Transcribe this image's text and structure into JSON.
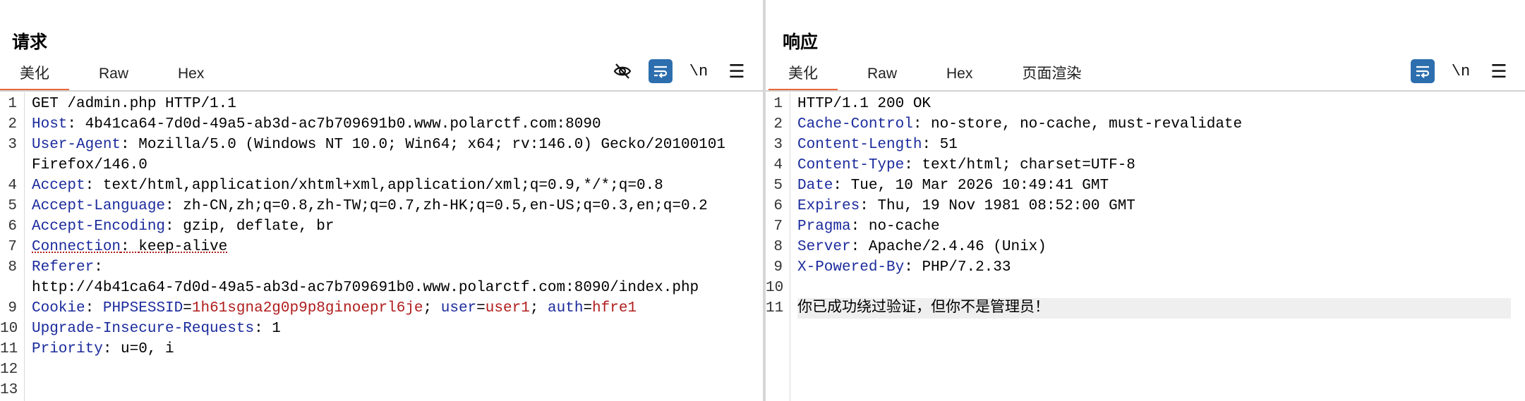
{
  "request": {
    "title": "请求",
    "tabs": [
      "美化",
      "Raw",
      "Hex"
    ],
    "active_tab": "美化",
    "toolbar_newline": "\\n",
    "lines": [
      {
        "num": "1",
        "name": "",
        "sep": "",
        "value": "GET /admin.php HTTP/1.1"
      },
      {
        "num": "2",
        "name": "Host",
        "sep": ": ",
        "value": "4b41ca64-7d0d-49a5-ab3d-ac7b709691b0.www.polarctf.com:8090"
      },
      {
        "num": "3",
        "name": "User-Agent",
        "sep": ": ",
        "value": "Mozilla/5.0 (Windows NT 10.0; Win64; x64; rv:146.0) Gecko/20100101"
      },
      {
        "num": "",
        "name": "",
        "sep": "",
        "value": "Firefox/146.0"
      },
      {
        "num": "4",
        "name": "Accept",
        "sep": ": ",
        "value": "text/html,application/xhtml+xml,application/xml;q=0.9,*/*;q=0.8"
      },
      {
        "num": "5",
        "name": "Accept-Language",
        "sep": ": ",
        "value": "zh-CN,zh;q=0.8,zh-TW;q=0.7,zh-HK;q=0.5,en-US;q=0.3,en;q=0.2"
      },
      {
        "num": "6",
        "name": "Accept-Encoding",
        "sep": ": ",
        "value": "gzip, deflate, br"
      },
      {
        "num": "7",
        "name": "Connection",
        "sep": ": ",
        "value": "keep-alive"
      },
      {
        "num": "8",
        "name": "Referer",
        "sep": ":",
        "value": ""
      },
      {
        "num": "",
        "name": "",
        "sep": "",
        "value": "http://4b41ca64-7d0d-49a5-ab3d-ac7b709691b0.www.polarctf.com:8090/index.php"
      },
      {
        "num": "9",
        "name": "Cookie",
        "sep": ": ",
        "value": ""
      },
      {
        "num": "10",
        "name": "Upgrade-Insecure-Requests",
        "sep": ": ",
        "value": "1"
      },
      {
        "num": "11",
        "name": "Priority",
        "sep": ": ",
        "value": "u=0, i"
      },
      {
        "num": "12",
        "name": "",
        "sep": "",
        "value": ""
      },
      {
        "num": "13",
        "name": "",
        "sep": "",
        "value": ""
      }
    ],
    "cookies": [
      {
        "name": "PHPSESSID",
        "value": "1h61sgna2g0p9p8ginoeprl6je"
      },
      {
        "name": "user",
        "value": "user1"
      },
      {
        "name": "auth",
        "value": "hfre1"
      }
    ]
  },
  "response": {
    "title": "响应",
    "tabs": [
      "美化",
      "Raw",
      "Hex",
      "页面渲染"
    ],
    "active_tab": "美化",
    "toolbar_newline": "\\n",
    "lines": [
      {
        "num": "1",
        "name": "",
        "sep": "",
        "value": "HTTP/1.1 200 OK"
      },
      {
        "num": "2",
        "name": "Cache-Control",
        "sep": ": ",
        "value": "no-store, no-cache, must-revalidate"
      },
      {
        "num": "3",
        "name": "Content-Length",
        "sep": ": ",
        "value": "51"
      },
      {
        "num": "4",
        "name": "Content-Type",
        "sep": ": ",
        "value": "text/html; charset=UTF-8"
      },
      {
        "num": "5",
        "name": "Date",
        "sep": ": ",
        "value": "Tue, 10 Mar 2026 10:49:41 GMT"
      },
      {
        "num": "6",
        "name": "Expires",
        "sep": ": ",
        "value": "Thu, 19 Nov 1981 08:52:00 GMT"
      },
      {
        "num": "7",
        "name": "Pragma",
        "sep": ": ",
        "value": "no-cache"
      },
      {
        "num": "8",
        "name": "Server",
        "sep": ": ",
        "value": "Apache/2.4.46 (Unix)"
      },
      {
        "num": "9",
        "name": "X-Powered-By",
        "sep": ": ",
        "value": "PHP/7.2.33"
      },
      {
        "num": "10",
        "name": "",
        "sep": "",
        "value": ""
      },
      {
        "num": "11",
        "name": "",
        "sep": "",
        "value": "你已成功绕过验证，但你不是管理员！"
      }
    ]
  },
  "colors": {
    "accent_tab": "#e8673c",
    "toggle_on": "#2d6fae",
    "header_name": "#1b2b9c",
    "cookie_value": "#b01c1c"
  },
  "icons": {
    "hide": "eye-slash-icon",
    "wrap": "word-wrap-icon",
    "newline": "newline-toggle-icon",
    "menu": "hamburger-menu-icon",
    "layout_side": "layout-side-by-side-icon",
    "layout_stacked": "layout-stacked-icon",
    "layout_tabs": "layout-tabs-icon"
  }
}
